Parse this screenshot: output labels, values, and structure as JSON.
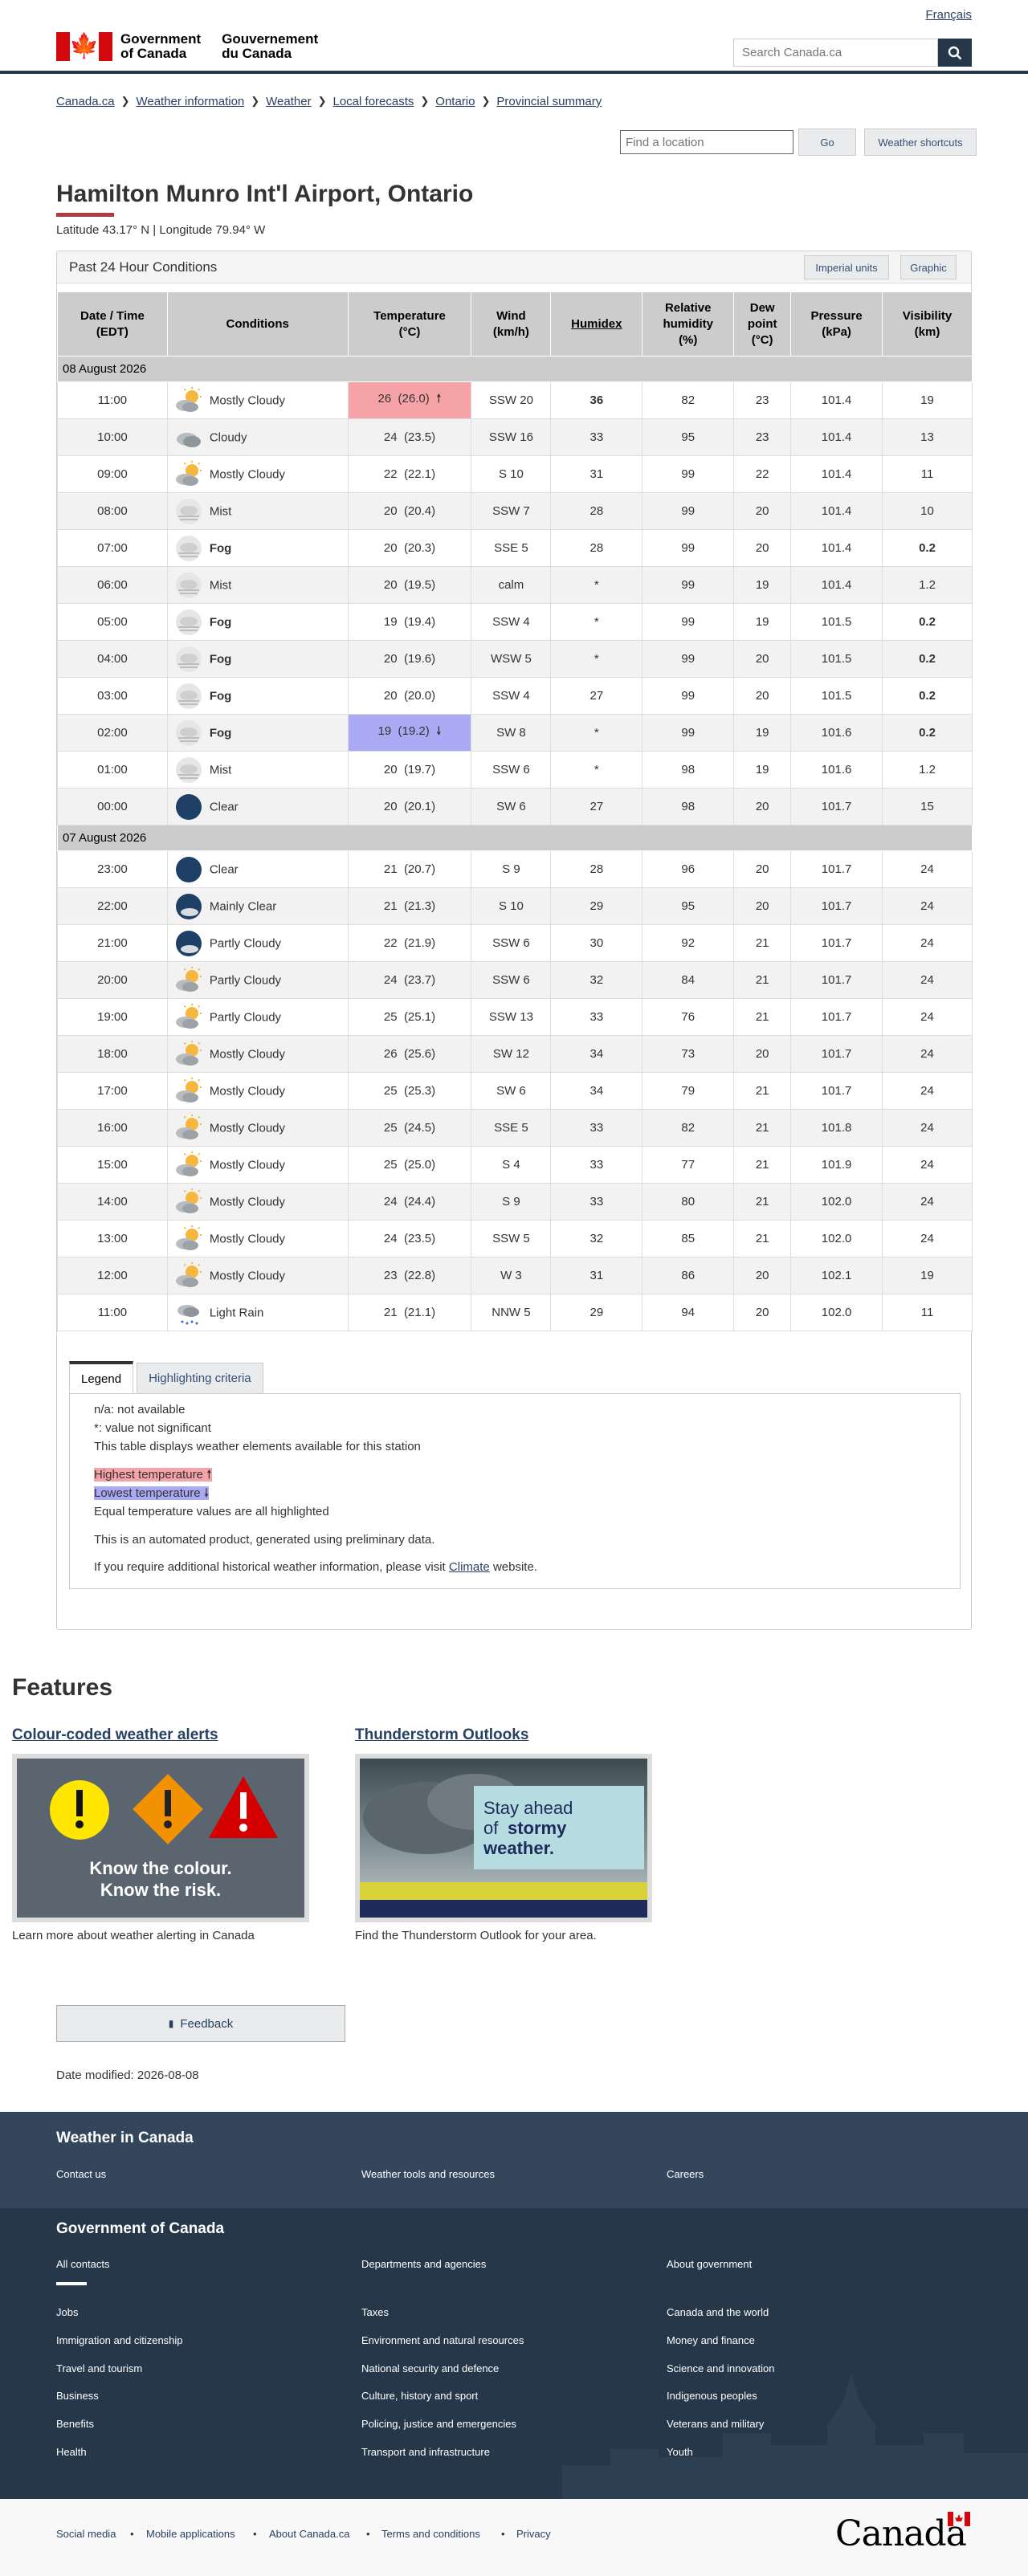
{
  "header": {
    "lang_link": "Français",
    "gov_en": [
      "Government",
      "of Canada"
    ],
    "gov_fr": [
      "Gouvernement",
      "du Canada"
    ],
    "search_placeholder": "Search Canada.ca"
  },
  "breadcrumb": [
    "Canada.ca",
    "Weather information",
    "Weather",
    "Local forecasts",
    "Ontario",
    "Provincial summary"
  ],
  "tools": {
    "location_placeholder": "Find a location",
    "go_label": "Go",
    "shortcuts_label": "Weather shortcuts"
  },
  "page": {
    "title": "Hamilton Munro Int'l Airport, Ontario",
    "latlon": "Latitude 43.17° N | Longitude 79.94° W"
  },
  "panel": {
    "title": "Past 24 Hour Conditions",
    "imperial_label": "Imperial units",
    "graphic_label": "Graphic"
  },
  "table": {
    "headers": [
      "Date / Time\n(EDT)",
      "Conditions",
      "Temperature\n(°C)",
      "Wind\n(km/h)",
      "Humidex",
      "Relative\nhumidity\n(%)",
      "Dew\npoint\n(°C)",
      "Pressure\n(kPa)",
      "Visibility\n(km)"
    ],
    "days": [
      {
        "date": "08 August 2026",
        "rows": [
          {
            "time": "11:00",
            "icon": "sun-cloud",
            "cond": "Mostly Cloudy",
            "cbold": false,
            "temp": "26",
            "temp2": "(26.0)",
            "mark": "hi",
            "wind": "SSW 20",
            "hx": "36",
            "hxb": true,
            "rh": "82",
            "dp": "23",
            "pr": "101.4",
            "vis": "19",
            "visb": false
          },
          {
            "time": "10:00",
            "icon": "cloud",
            "cond": "Cloudy",
            "cbold": false,
            "temp": "24",
            "temp2": "(23.5)",
            "mark": "",
            "wind": "SSW 16",
            "hx": "33",
            "hxb": false,
            "rh": "95",
            "dp": "23",
            "pr": "101.4",
            "vis": "13",
            "visb": false
          },
          {
            "time": "09:00",
            "icon": "sun-cloud",
            "cond": "Mostly Cloudy",
            "cbold": false,
            "temp": "22",
            "temp2": "(22.1)",
            "mark": "",
            "wind": "S 10",
            "hx": "31",
            "hxb": false,
            "rh": "99",
            "dp": "22",
            "pr": "101.4",
            "vis": "11",
            "visb": false
          },
          {
            "time": "08:00",
            "icon": "fog",
            "cond": "Mist",
            "cbold": false,
            "temp": "20",
            "temp2": "(20.4)",
            "mark": "",
            "wind": "SSW 7",
            "hx": "28",
            "hxb": false,
            "rh": "99",
            "dp": "20",
            "pr": "101.4",
            "vis": "10",
            "visb": false
          },
          {
            "time": "07:00",
            "icon": "fog",
            "cond": "Fog",
            "cbold": true,
            "temp": "20",
            "temp2": "(20.3)",
            "mark": "",
            "wind": "SSE 5",
            "hx": "28",
            "hxb": false,
            "rh": "99",
            "dp": "20",
            "pr": "101.4",
            "vis": "0.2",
            "visb": true
          },
          {
            "time": "06:00",
            "icon": "fog",
            "cond": "Mist",
            "cbold": false,
            "temp": "20",
            "temp2": "(19.5)",
            "mark": "",
            "wind": "calm",
            "hx": "*",
            "hxb": false,
            "rh": "99",
            "dp": "19",
            "pr": "101.4",
            "vis": "1.2",
            "visb": false
          },
          {
            "time": "05:00",
            "icon": "fog",
            "cond": "Fog",
            "cbold": true,
            "temp": "19",
            "temp2": "(19.4)",
            "mark": "",
            "wind": "SSW 4",
            "hx": "*",
            "hxb": false,
            "rh": "99",
            "dp": "19",
            "pr": "101.5",
            "vis": "0.2",
            "visb": true
          },
          {
            "time": "04:00",
            "icon": "fog",
            "cond": "Fog",
            "cbold": true,
            "temp": "20",
            "temp2": "(19.6)",
            "mark": "",
            "wind": "WSW 5",
            "hx": "*",
            "hxb": false,
            "rh": "99",
            "dp": "20",
            "pr": "101.5",
            "vis": "0.2",
            "visb": true
          },
          {
            "time": "03:00",
            "icon": "fog",
            "cond": "Fog",
            "cbold": true,
            "temp": "20",
            "temp2": "(20.0)",
            "mark": "",
            "wind": "SSW 4",
            "hx": "27",
            "hxb": false,
            "rh": "99",
            "dp": "20",
            "pr": "101.5",
            "vis": "0.2",
            "visb": true
          },
          {
            "time": "02:00",
            "icon": "fog",
            "cond": "Fog",
            "cbold": true,
            "temp": "19",
            "temp2": "(19.2)",
            "mark": "lo",
            "wind": "SW 8",
            "hx": "*",
            "hxb": false,
            "rh": "99",
            "dp": "19",
            "pr": "101.6",
            "vis": "0.2",
            "visb": true
          },
          {
            "time": "01:00",
            "icon": "fog",
            "cond": "Mist",
            "cbold": false,
            "temp": "20",
            "temp2": "(19.7)",
            "mark": "",
            "wind": "SSW 6",
            "hx": "*",
            "hxb": false,
            "rh": "98",
            "dp": "19",
            "pr": "101.6",
            "vis": "1.2",
            "visb": false
          },
          {
            "time": "00:00",
            "icon": "moon",
            "cond": "Clear",
            "cbold": false,
            "temp": "20",
            "temp2": "(20.1)",
            "mark": "",
            "wind": "SW 6",
            "hx": "27",
            "hxb": false,
            "rh": "98",
            "dp": "20",
            "pr": "101.7",
            "vis": "15",
            "visb": false
          }
        ]
      },
      {
        "date": "07 August 2026",
        "rows": [
          {
            "time": "23:00",
            "icon": "moon",
            "cond": "Clear",
            "cbold": false,
            "temp": "21",
            "temp2": "(20.7)",
            "mark": "",
            "wind": "S 9",
            "hx": "28",
            "hxb": false,
            "rh": "96",
            "dp": "20",
            "pr": "101.7",
            "vis": "24",
            "visb": false
          },
          {
            "time": "22:00",
            "icon": "moon-cloud",
            "cond": "Mainly Clear",
            "cbold": false,
            "temp": "21",
            "temp2": "(21.3)",
            "mark": "",
            "wind": "S 10",
            "hx": "29",
            "hxb": false,
            "rh": "95",
            "dp": "20",
            "pr": "101.7",
            "vis": "24",
            "visb": false
          },
          {
            "time": "21:00",
            "icon": "moon-cloud",
            "cond": "Partly Cloudy",
            "cbold": false,
            "temp": "22",
            "temp2": "(21.9)",
            "mark": "",
            "wind": "SSW 6",
            "hx": "30",
            "hxb": false,
            "rh": "92",
            "dp": "21",
            "pr": "101.7",
            "vis": "24",
            "visb": false
          },
          {
            "time": "20:00",
            "icon": "sun-cloud",
            "cond": "Partly Cloudy",
            "cbold": false,
            "temp": "24",
            "temp2": "(23.7)",
            "mark": "",
            "wind": "SSW 6",
            "hx": "32",
            "hxb": false,
            "rh": "84",
            "dp": "21",
            "pr": "101.7",
            "vis": "24",
            "visb": false
          },
          {
            "time": "19:00",
            "icon": "sun-cloud",
            "cond": "Partly Cloudy",
            "cbold": false,
            "temp": "25",
            "temp2": "(25.1)",
            "mark": "",
            "wind": "SSW 13",
            "hx": "33",
            "hxb": false,
            "rh": "76",
            "dp": "21",
            "pr": "101.7",
            "vis": "24",
            "visb": false
          },
          {
            "time": "18:00",
            "icon": "sun-cloud",
            "cond": "Mostly Cloudy",
            "cbold": false,
            "temp": "26",
            "temp2": "(25.6)",
            "mark": "",
            "wind": "SW 12",
            "hx": "34",
            "hxb": false,
            "rh": "73",
            "dp": "20",
            "pr": "101.7",
            "vis": "24",
            "visb": false
          },
          {
            "time": "17:00",
            "icon": "sun-cloud",
            "cond": "Mostly Cloudy",
            "cbold": false,
            "temp": "25",
            "temp2": "(25.3)",
            "mark": "",
            "wind": "SW 6",
            "hx": "34",
            "hxb": false,
            "rh": "79",
            "dp": "21",
            "pr": "101.7",
            "vis": "24",
            "visb": false
          },
          {
            "time": "16:00",
            "icon": "sun-cloud",
            "cond": "Mostly Cloudy",
            "cbold": false,
            "temp": "25",
            "temp2": "(24.5)",
            "mark": "",
            "wind": "SSE 5",
            "hx": "33",
            "hxb": false,
            "rh": "82",
            "dp": "21",
            "pr": "101.8",
            "vis": "24",
            "visb": false
          },
          {
            "time": "15:00",
            "icon": "sun-cloud",
            "cond": "Mostly Cloudy",
            "cbold": false,
            "temp": "25",
            "temp2": "(25.0)",
            "mark": "",
            "wind": "S 4",
            "hx": "33",
            "hxb": false,
            "rh": "77",
            "dp": "21",
            "pr": "101.9",
            "vis": "24",
            "visb": false
          },
          {
            "time": "14:00",
            "icon": "sun-cloud",
            "cond": "Mostly Cloudy",
            "cbold": false,
            "temp": "24",
            "temp2": "(24.4)",
            "mark": "",
            "wind": "S 9",
            "hx": "33",
            "hxb": false,
            "rh": "80",
            "dp": "21",
            "pr": "102.0",
            "vis": "24",
            "visb": false
          },
          {
            "time": "13:00",
            "icon": "sun-cloud",
            "cond": "Mostly Cloudy",
            "cbold": false,
            "temp": "24",
            "temp2": "(23.5)",
            "mark": "",
            "wind": "SSW 5",
            "hx": "32",
            "hxb": false,
            "rh": "85",
            "dp": "21",
            "pr": "102.0",
            "vis": "24",
            "visb": false
          },
          {
            "time": "12:00",
            "icon": "sun-cloud",
            "cond": "Mostly Cloudy",
            "cbold": false,
            "temp": "23",
            "temp2": "(22.8)",
            "mark": "",
            "wind": "W 3",
            "hx": "31",
            "hxb": false,
            "rh": "86",
            "dp": "20",
            "pr": "102.1",
            "vis": "19",
            "visb": false
          },
          {
            "time": "11:00",
            "icon": "rain",
            "cond": "Light Rain",
            "cbold": false,
            "temp": "21",
            "temp2": "(21.1)",
            "mark": "",
            "wind": "NNW 5",
            "hx": "29",
            "hxb": false,
            "rh": "94",
            "dp": "20",
            "pr": "102.0",
            "vis": "11",
            "visb": false
          }
        ]
      }
    ]
  },
  "legend": {
    "tab_legend": "Legend",
    "tab_highlight": "Highlighting criteria",
    "na": "n/a: not available",
    "star": "*: value not significant",
    "elements": "This table displays weather elements available for this station",
    "highest": "Highest temperature",
    "lowest": "Lowest temperature",
    "equal": "Equal temperature values are all highlighted",
    "automated": "This is an automated product, generated using preliminary data.",
    "hist_pre": "If you require additional historical weather information, please visit",
    "hist_link": "Climate",
    "hist_post": "website."
  },
  "features": {
    "heading": "Features",
    "card1": {
      "title": "Colour-coded weather alerts",
      "img_text": [
        "Know the colour.",
        "Know the risk."
      ],
      "caption": "Learn more about weather alerting in Canada"
    },
    "card2": {
      "title": "Thunderstorm Outlooks",
      "img_text": [
        "Stay ahead",
        "of",
        "stormy",
        "weather."
      ],
      "caption": "Find the Thunderstorm Outlook for your area."
    }
  },
  "feedback_label": "Feedback",
  "date_modified": "Date modified: 2026-08-08",
  "footer": {
    "weather_title": "Weather in Canada",
    "weather_links": [
      "Contact us",
      "Weather tools and resources",
      "Careers"
    ],
    "gov_title": "Government of Canada",
    "gov_links_top": [
      "All contacts",
      "Departments and agencies",
      "About government"
    ],
    "gov_links": [
      [
        "Jobs",
        "Taxes",
        "Canada and the world"
      ],
      [
        "Immigration and citizenship",
        "Environment and natural resources",
        "Money and finance"
      ],
      [
        "Travel and tourism",
        "National security and defence",
        "Science and innovation"
      ],
      [
        "Business",
        "Culture, history and sport",
        "Indigenous peoples"
      ],
      [
        "Benefits",
        "Policing, justice and emergencies",
        "Veterans and military"
      ],
      [
        "Health",
        "Transport and infrastructure",
        "Youth"
      ]
    ],
    "bottom_links": [
      "Social media",
      "Mobile applications",
      "About Canada.ca",
      "Terms and conditions",
      "Privacy"
    ],
    "wordmark": "Canada"
  },
  "colors": {
    "header_blue": "#26374a",
    "highlight_hi": "#f5a3a7",
    "highlight_lo": "#a9a9f4",
    "title_rule": "#af3c43"
  }
}
